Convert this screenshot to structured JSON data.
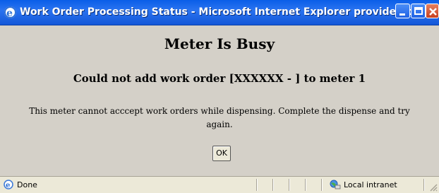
{
  "window": {
    "title": "Work Order Processing Status - Microsoft Internet Explorer provided by Gra...",
    "icon": "ie-icon",
    "controls": [
      "minimize",
      "maximize",
      "close"
    ]
  },
  "dialog": {
    "heading": "Meter Is Busy",
    "subheading": "Could not add work order [XXXXXX - ] to meter 1",
    "message": "This meter cannot acccept work orders while dispensing. Complete the dispense and try again.",
    "ok_label": "OK"
  },
  "statusbar": {
    "status": "Done",
    "zone": "Local intranet",
    "zone_icon": "intranet-globe-icon"
  },
  "colors": {
    "titlebar": "#2a73f0",
    "content_bg": "#d4d0c8",
    "statusbar_bg": "#ece9d8"
  }
}
